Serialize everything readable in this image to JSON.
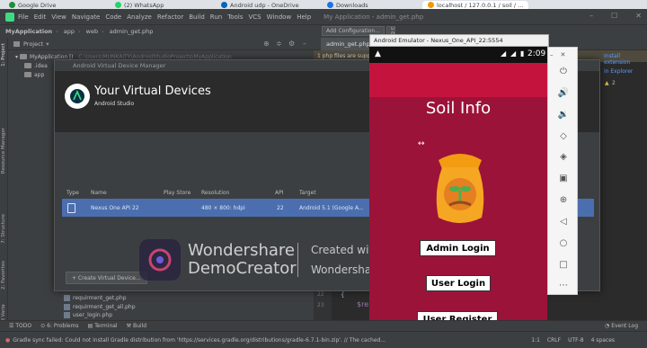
{
  "browser_tabs": [
    {
      "label": "Google Drive",
      "color": "#1e8e3e"
    },
    {
      "label": "(2) WhatsApp",
      "color": "#25d366"
    },
    {
      "label": "Android udp - OneDrive",
      "color": "#0364b8"
    },
    {
      "label": "Downloads",
      "color": "#1a73e8"
    },
    {
      "label": "localhost / 127.0.0.1 / soil / ...",
      "color": "#f29900"
    }
  ],
  "menu": {
    "items": [
      "File",
      "Edit",
      "View",
      "Navigate",
      "Code",
      "Analyze",
      "Refactor",
      "Build",
      "Run",
      "Tools",
      "VCS",
      "Window",
      "Help"
    ],
    "window_title": "My Application - admin_get.php"
  },
  "navbar": {
    "crumbs": [
      "MyApplication",
      "app",
      "web",
      "admin_get.php"
    ],
    "add_config": "Add Configuration...",
    "device": "Loading Device..."
  },
  "project": {
    "header": "Project",
    "root": "MyApplication [I",
    "root_path": "C:\\Users\\MUNKAITY\\AndroidStudioProjects\\MyApplication",
    "rows": [
      ".idea",
      "app",
      "requirment_get.php",
      "requirment_get_all.php",
      "user_login.php"
    ]
  },
  "side_labels": {
    "project": "1: Project",
    "resource": "Resource Manager",
    "structure": "7: Structure",
    "favorites": "2: Favorites",
    "variants": "Build Variants"
  },
  "editor": {
    "tab": "admin_get.php",
    "banner": "1 php files are supp...",
    "install": "Install extension",
    "explorer": "in Explorer",
    "line22": "22",
    "line23": "23",
    "code1": "{",
    "code2": "$re",
    "warn": "2"
  },
  "avd": {
    "window_title": "Android Virtual Device Manager",
    "heading": "Your Virtual Devices",
    "subheading": "Android Studio",
    "columns": [
      "Type",
      "Name",
      "Play Store",
      "Resolution",
      "API",
      "Target"
    ],
    "device": {
      "name": "Nexus One API 22",
      "resolution": "480 × 800: hdpi",
      "api": "22",
      "target": "Android 5.1 (Google A..."
    },
    "create_button": "+ Create Virtual Device..."
  },
  "watermark": {
    "brand1": "Wondershare",
    "brand2": "DemoCreator",
    "created": "Created with",
    "plan": "Wondershare DemoCreator free plan"
  },
  "emulator": {
    "title": "Android Emulator - Nexus_One_API_22:5554",
    "time": "2:09",
    "app_title": "Soil Info",
    "buttons": {
      "admin": "Admin Login",
      "user": "User Login",
      "register": "User Register"
    }
  },
  "bottom": {
    "todo": "TODO",
    "problems": "6: Problems",
    "terminal": "Terminal",
    "build": "Build",
    "event_log": "Event Log"
  },
  "status": {
    "message": "Gradle sync failed: Could not install Gradle distribution from 'https://services.gradle.org/distributions/gradle-6.7.1-bin.zip'. // The cached...",
    "position": "1:1",
    "line_sep": "CRLF",
    "encoding": "UTF-8",
    "indent": "4 spaces"
  },
  "colors": {
    "ide_bg": "#2b2b2b",
    "panel": "#3c3f41",
    "selection": "#4b6eaf",
    "app_red": "#c4143d",
    "app_body": "#9c1339"
  }
}
